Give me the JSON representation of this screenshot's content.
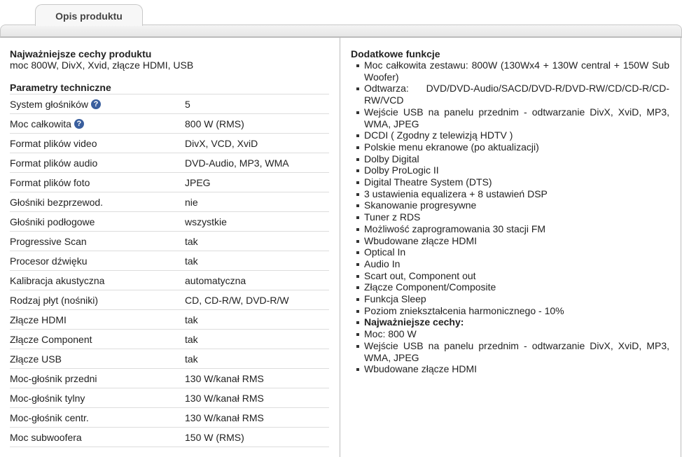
{
  "tab": {
    "label": "Opis produktu"
  },
  "left": {
    "highlights_title": "Najważniejsze cechy produktu",
    "highlights_text": "moc 800W, DivX, Xvid, złącze HDMI, USB",
    "params_title": "Parametry techniczne",
    "rows": [
      {
        "k": "System głośników",
        "v": "5",
        "help": true
      },
      {
        "k": "Moc całkowita",
        "v": "800 W (RMS)",
        "help": true
      },
      {
        "k": "Format plików video",
        "v": "DivX, VCD, XviD"
      },
      {
        "k": "Format plików audio",
        "v": "DVD-Audio, MP3, WMA"
      },
      {
        "k": "Format plików foto",
        "v": "JPEG"
      },
      {
        "k": "Głośniki bezprzewod.",
        "v": "nie"
      },
      {
        "k": "Głośniki podłogowe",
        "v": "wszystkie"
      },
      {
        "k": "Progressive Scan",
        "v": "tak"
      },
      {
        "k": "Procesor dźwięku",
        "v": "tak"
      },
      {
        "k": "Kalibracja akustyczna",
        "v": "automatyczna"
      },
      {
        "k": "Rodzaj płyt (nośniki)",
        "v": "CD, CD-R/W, DVD-R/W"
      },
      {
        "k": "Złącze HDMI",
        "v": "tak"
      },
      {
        "k": "Złącze Component",
        "v": "tak"
      },
      {
        "k": "Złącze USB",
        "v": "tak"
      },
      {
        "k": "Moc-głośnik przedni",
        "v": "130 W/kanał RMS"
      },
      {
        "k": "Moc-głośnik tylny",
        "v": "130 W/kanał RMS"
      },
      {
        "k": "Moc-głośnik centr.",
        "v": "130 W/kanał RMS"
      },
      {
        "k": "Moc subwoofera",
        "v": "150 W (RMS)"
      }
    ],
    "help_glyph": "?"
  },
  "right": {
    "title": "Dodatkowe funkcje",
    "items": [
      {
        "t": "Moc całkowita zestawu: 800W (130Wx4 + 130W central + 150W Sub Woofer)"
      },
      {
        "t": "Odtwarza: DVD/DVD-Audio/SACD/DVD-R/DVD-RW/CD/CD-R/CD-RW/VCD"
      },
      {
        "t": "Wejście USB na panelu przednim - odtwarzanie DivX, XviD, MP3, WMA, JPEG"
      },
      {
        "t": "DCDI ( Zgodny z telewizją HDTV )"
      },
      {
        "t": "Polskie menu ekranowe (po aktualizacji)"
      },
      {
        "t": "Dolby Digital"
      },
      {
        "t": "Dolby ProLogic II"
      },
      {
        "t": "Digital Theatre System (DTS)"
      },
      {
        "t": "3 ustawienia equalizera + 8 ustawień DSP"
      },
      {
        "t": "Skanowanie progresywne"
      },
      {
        "t": "Tuner z RDS"
      },
      {
        "t": "Możliwość zaprogramowania 30 stacji FM"
      },
      {
        "t": "Wbudowane złącze HDMI"
      },
      {
        "t": "Optical In"
      },
      {
        "t": "Audio In"
      },
      {
        "t": "Scart out, Component out"
      },
      {
        "t": "Złącze Component/Composite"
      },
      {
        "t": "Funkcja Sleep"
      },
      {
        "t": "Poziom zniekształcenia harmonicznego - 10%"
      },
      {
        "t": "Najważniejsze cechy:",
        "bold": true
      },
      {
        "t": "Moc: 800 W"
      },
      {
        "t": "Wejście USB na panelu przednim - odtwarzanie DivX, XviD, MP3, WMA, JPEG"
      },
      {
        "t": "Wbudowane złącze HDMI"
      }
    ]
  }
}
